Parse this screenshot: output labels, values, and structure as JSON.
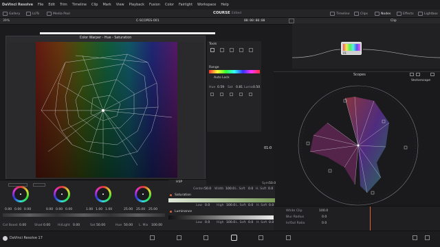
{
  "menu": {
    "items": [
      "DaVinci Resolve",
      "File",
      "Edit",
      "Trim",
      "Timeline",
      "Clip",
      "Mark",
      "View",
      "Playback",
      "Fusion",
      "Color",
      "Fairlight",
      "Workspace",
      "Help"
    ]
  },
  "toolbar": {
    "left": [
      "Gallery",
      "LUTs",
      "Media Pool"
    ],
    "project": "COURSE",
    "project_state": "Edited",
    "right": [
      "Timeline",
      "Clips",
      "Nodes",
      "Effects",
      "Lightbox"
    ]
  },
  "subbar": {
    "zoom": "39%",
    "clip_name": "C-SCOPES-001",
    "timecode": "00:00:00:00",
    "node_mode": "Clip"
  },
  "viewer": {
    "title": "Color Warper - Hue - Saturation",
    "mode": "HSP"
  },
  "tools": {
    "title": "Tools",
    "range_label": "Range",
    "auto_lock": "Auto Lock",
    "hue_label": "Hue",
    "hue": "0.59",
    "sat_label": "Sat",
    "sat": "0.81",
    "luma_label": "Luma",
    "luma": "0.50"
  },
  "node": {
    "label": "01"
  },
  "scopes": {
    "title": "Scopes",
    "type": "Vectorscope",
    "time_label": "01:0"
  },
  "wheels": {
    "groups": [
      {
        "values": [
          "0.00",
          "0.00",
          "0.00"
        ]
      },
      {
        "values": [
          "0.00",
          "0.00",
          "0.00"
        ]
      },
      {
        "values": [
          "1.00",
          "1.00",
          "1.00"
        ]
      },
      {
        "values": [
          "25.00",
          "25.00",
          "25.00"
        ]
      }
    ],
    "params": [
      {
        "label": "Col Boost",
        "value": "0.00"
      },
      {
        "label": "Shad",
        "value": "0.00"
      },
      {
        "label": "Hi/Light",
        "value": "0.00"
      },
      {
        "label": "Sat",
        "value": "50.00"
      },
      {
        "label": "Hue",
        "value": "50.00"
      },
      {
        "label": "L. Mix",
        "value": "100.00"
      }
    ]
  },
  "qualifier": {
    "top": [
      {
        "label": "Center",
        "value": "50.0"
      },
      {
        "label": "Width",
        "value": "100.0"
      },
      {
        "label": "L. Soft",
        "value": "0.0"
      },
      {
        "label": "H. Soft",
        "value": "0.0"
      }
    ],
    "sym_label": "Sym",
    "sym_value": "50.0",
    "saturation_label": "Saturation",
    "sat_row": [
      {
        "label": "Low",
        "value": "0.0"
      },
      {
        "label": "High",
        "value": "100.0"
      },
      {
        "label": "L. Soft",
        "value": "0.0"
      },
      {
        "label": "H. Soft",
        "value": "0.0"
      }
    ],
    "luminance_label": "Luminance",
    "lum_row": [
      {
        "label": "Low",
        "value": "0.0"
      },
      {
        "label": "High",
        "value": "100.0"
      },
      {
        "label": "L. Soft",
        "value": "0.0"
      },
      {
        "label": "H. Soft",
        "value": "0.0"
      }
    ]
  },
  "keys": {
    "rows": [
      {
        "label": "White Clip",
        "value": "100.0"
      },
      {
        "label": "Blur Radius",
        "value": "0.0"
      },
      {
        "label": "In/Out Ratio",
        "value": "0.0"
      }
    ]
  },
  "bottom": {
    "app_label": "DaVinci Resolve 17"
  },
  "colors": {
    "accent": "#e0663a",
    "panel": "#232326",
    "bg": "#1b1b1d"
  }
}
